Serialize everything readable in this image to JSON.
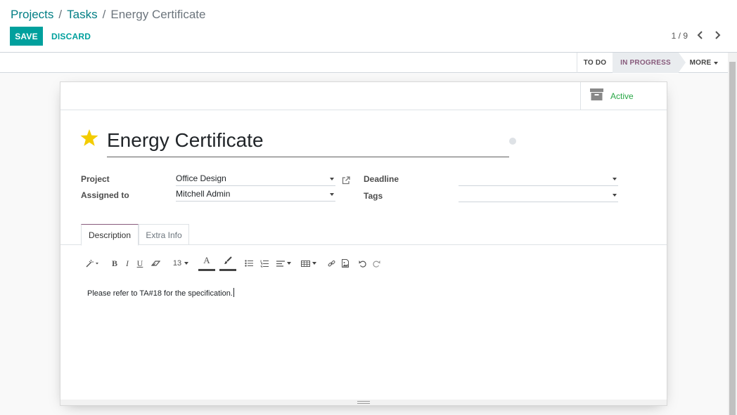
{
  "breadcrumb": {
    "items": [
      "Projects",
      "Tasks"
    ],
    "separator": "/",
    "current": "Energy Certificate"
  },
  "toolbar": {
    "save_label": "SAVE",
    "discard_label": "DISCARD"
  },
  "pager": {
    "value": "1 / 9"
  },
  "stages": {
    "todo": "TO DO",
    "in_progress": "IN PROGRESS",
    "more": "MORE"
  },
  "smart_button": {
    "label": "Active",
    "icon": "archive-icon"
  },
  "task": {
    "title": "Energy Certificate",
    "starred": true
  },
  "fields": {
    "project_label": "Project",
    "project_value": "Office Design",
    "assigned_label": "Assigned to",
    "assigned_value": "Mitchell Admin",
    "deadline_label": "Deadline",
    "deadline_value": "",
    "tags_label": "Tags",
    "tags_value": ""
  },
  "tabs": {
    "description": "Description",
    "extra_info": "Extra Info"
  },
  "editor": {
    "font_size": "13",
    "text": "Please refer to TA#18 for the specification."
  },
  "colors": {
    "primary": "#00a09d",
    "link": "#017e84",
    "stage_active": "#875a7b",
    "active_green": "#28a745",
    "star": "#f3cc00"
  }
}
